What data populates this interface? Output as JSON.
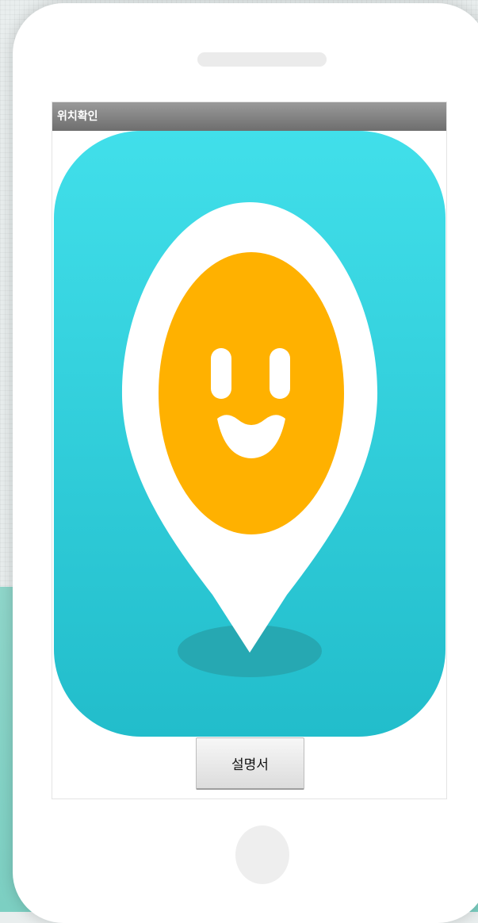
{
  "app": {
    "title": "위치확인"
  },
  "main": {
    "manual_button_label": "설명서"
  },
  "icons": {
    "app_icon": "location-pin-smiley-icon"
  },
  "colors": {
    "title_bar": "#7a7a7a",
    "icon_background": "#36d2df",
    "pin": "#ffffff",
    "face": "#ffb100",
    "shadow": "#27a3ad"
  }
}
